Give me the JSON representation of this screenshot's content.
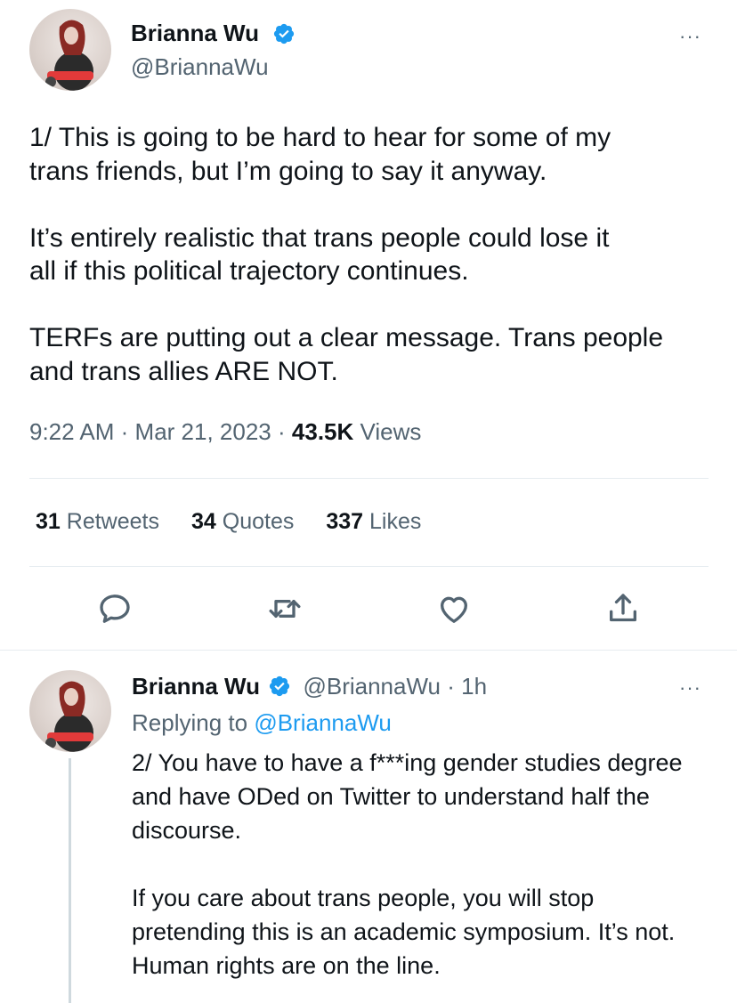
{
  "tweet": {
    "author": {
      "name": "Brianna Wu",
      "handle": "@BriannaWu",
      "verified_color": "#1d9bf0"
    },
    "paragraphs": [
      {
        "lines": [
          "1/ This is going to be hard to hear for some of my",
          "trans friends, but I’m going to say it anyway."
        ]
      },
      {
        "lines": [
          "It’s entirely realistic that trans people could lose it",
          "all if this political trajectory continues."
        ]
      },
      {
        "lines": [
          "TERFs are putting out a clear message. Trans people",
          "and trans allies ARE NOT."
        ]
      }
    ],
    "time": "9:22 AM",
    "date": "Mar 21, 2023",
    "views_count": "43.5K",
    "views_label": "Views",
    "separator": "·",
    "stats": {
      "retweets_count": "31",
      "retweets_label": "Retweets",
      "quotes_count": "34",
      "quotes_label": "Quotes",
      "likes_count": "337",
      "likes_label": "Likes"
    },
    "actions": [
      "reply-icon",
      "retweet-icon",
      "like-icon",
      "share-icon"
    ],
    "more_label": "···"
  },
  "reply": {
    "author": {
      "name": "Brianna Wu",
      "handle": "@BriannaWu",
      "time": "1h"
    },
    "replying_prefix": "Replying to",
    "replying_to": "@BriannaWu",
    "paragraphs": [
      "2/ You have to have a f***ing gender studies degree and have ODed on Twitter to understand half the discourse.",
      "If you care about trans people, you will stop pretending this is an academic symposium. It’s not. Human rights are on the line."
    ],
    "more_label": "···"
  },
  "colors": {
    "text": "#0f1419",
    "secondary": "#536471",
    "accent": "#1d9bf0",
    "divider": "#e6ecf0"
  }
}
